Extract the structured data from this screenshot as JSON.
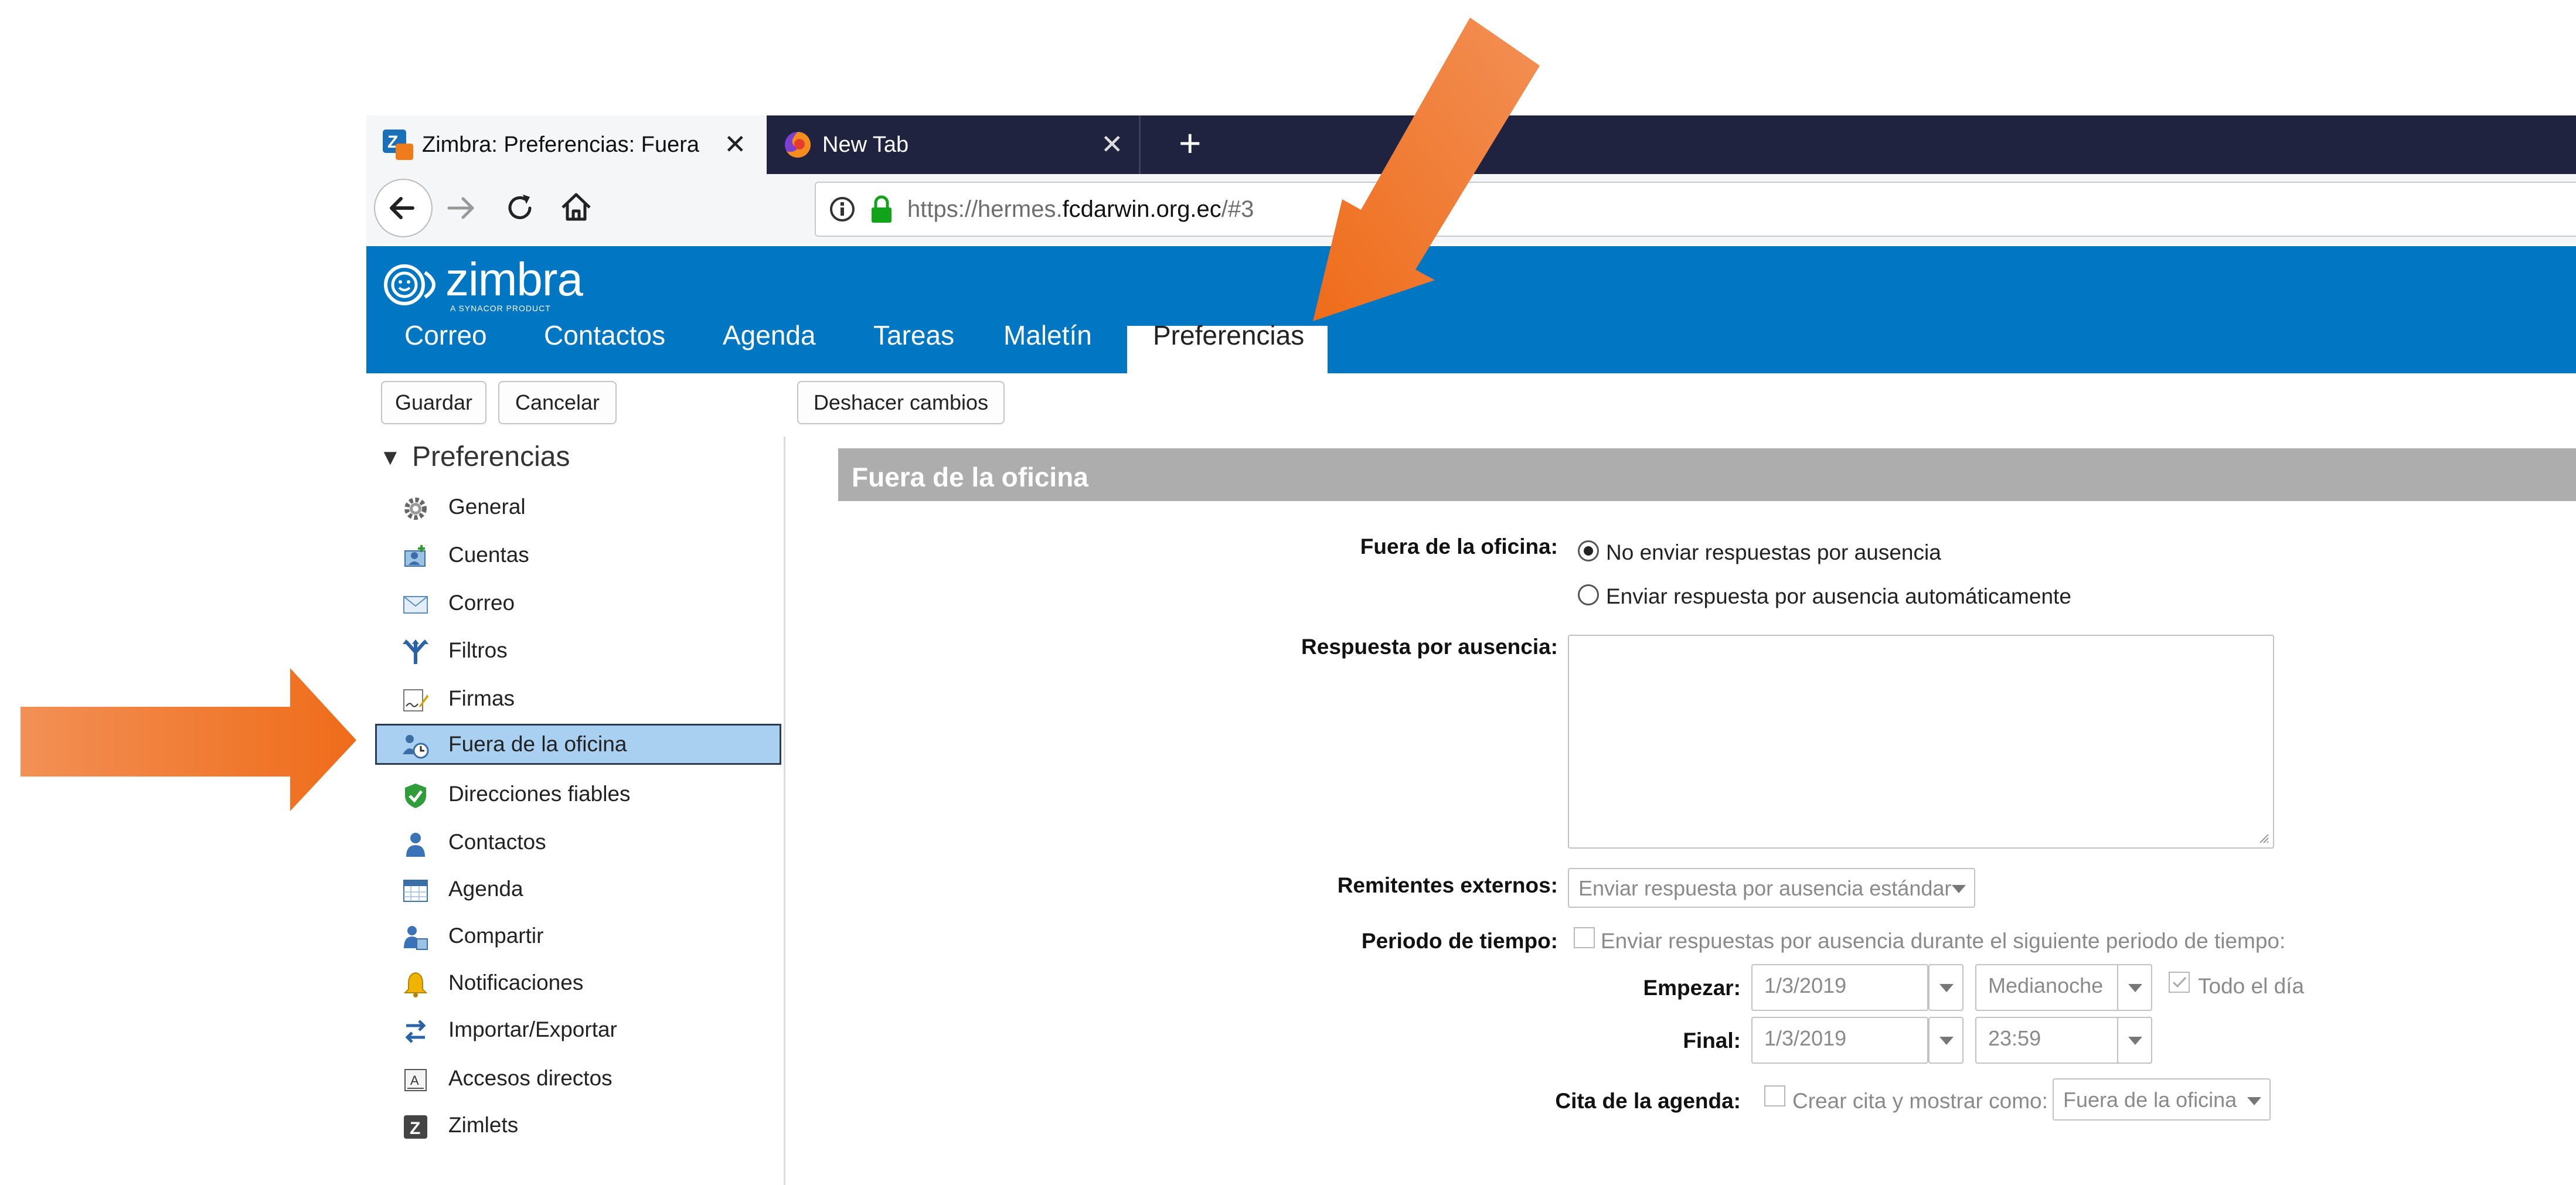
{
  "browser": {
    "tabs": [
      {
        "title": "Zimbra: Preferencias: Fuera de la oficina",
        "active": true
      },
      {
        "title": "New Tab",
        "active": false
      }
    ],
    "url_prefix": "https://hermes.",
    "url_domain": "fcdarwin.org.ec",
    "url_suffix": "/#3"
  },
  "app": {
    "logo_text": "zimbra",
    "logo_subtitle": "A SYNACOR PRODUCT",
    "nav_tabs": [
      "Correo",
      "Contactos",
      "Agenda",
      "Tareas",
      "Maletín",
      "Preferencias"
    ],
    "active_tab": "Preferencias",
    "brand_color": "#0176c3"
  },
  "toolbar": {
    "save_label": "Guardar",
    "cancel_label": "Cancelar",
    "undo_label": "Deshacer cambios"
  },
  "sidebar": {
    "title": "Preferencias",
    "items": [
      {
        "label": "General",
        "icon": "gear-icon"
      },
      {
        "label": "Cuentas",
        "icon": "accounts-icon"
      },
      {
        "label": "Correo",
        "icon": "envelope-icon"
      },
      {
        "label": "Filtros",
        "icon": "filter-icon"
      },
      {
        "label": "Firmas",
        "icon": "signature-icon"
      },
      {
        "label": "Fuera de la oficina",
        "icon": "out-of-office-icon",
        "selected": true
      },
      {
        "label": "Direcciones fiables",
        "icon": "shield-check-icon"
      },
      {
        "label": "Contactos",
        "icon": "person-icon"
      },
      {
        "label": "Agenda",
        "icon": "calendar-icon"
      },
      {
        "label": "Compartir",
        "icon": "share-icon"
      },
      {
        "label": "Notificaciones",
        "icon": "bell-icon"
      },
      {
        "label": "Importar/Exportar",
        "icon": "import-export-icon"
      },
      {
        "label": "Accesos directos",
        "icon": "shortcuts-icon"
      },
      {
        "label": "Zimlets",
        "icon": "zimlets-icon"
      }
    ]
  },
  "main": {
    "section_title": "Fuera de la oficina",
    "ooo_label": "Fuera de la oficina:",
    "ooo_options": [
      "No enviar respuestas por ausencia",
      "Enviar respuesta por ausencia automáticamente"
    ],
    "ooo_selected": 0,
    "reply_label": "Respuesta por ausencia:",
    "reply_value": "",
    "external_label": "Remitentes externos:",
    "external_value": "Enviar respuesta por ausencia estándar",
    "period_label": "Periodo de tiempo:",
    "period_text": "Enviar respuestas por ausencia durante el siguiente periodo de tiempo:",
    "start_label": "Empezar:",
    "start_date": "1/3/2019",
    "start_time": "Medianoche",
    "all_day_label": "Todo el día",
    "end_label": "Final:",
    "end_date": "1/3/2019",
    "end_time": "23:59",
    "calendar_label": "Cita de la agenda:",
    "calendar_text": "Crear cita y mostrar como:",
    "calendar_value": "Fuera de la oficina"
  }
}
